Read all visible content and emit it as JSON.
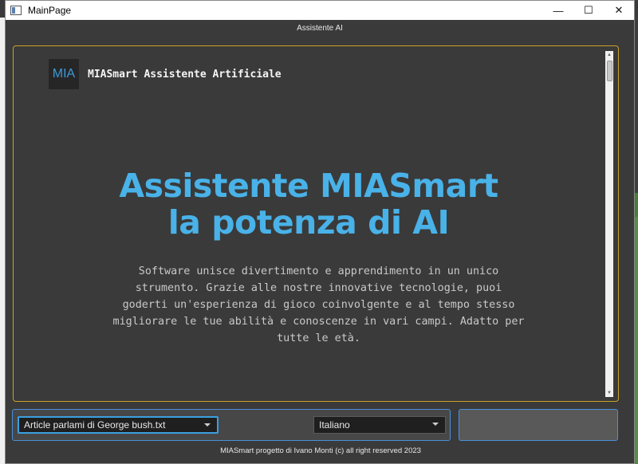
{
  "window": {
    "title": "MainPage",
    "minimize_glyph": "—",
    "maximize_glyph": "☐",
    "close_glyph": "✕"
  },
  "header": {
    "subtitle": "Assistente AI"
  },
  "brand": {
    "logo_text": "MIA",
    "name": "MIASmart Assistente Artificiale"
  },
  "hero": {
    "line1": "Assistente MIASmart",
    "line2": "la potenza di AI"
  },
  "description": {
    "lines": [
      "Software unisce divertimento e apprendimento in un unico",
      "strumento. Grazie alle nostre innovative tecnologie, puoi",
      "goderti un'esperienza di gioco coinvolgente e al tempo stesso",
      "migliorare le tue abilità e conoscenze in vari campi. Adatto per",
      "tutte le età."
    ]
  },
  "controls": {
    "article_select": "Article   parlami di George bush.txt",
    "language_select": "Italiano"
  },
  "footer": {
    "text": "MIASmart progetto di Ivano Monti (c) all right reserved 2023"
  },
  "colors": {
    "accent": "#49b2e8",
    "content_border": "#c9a227",
    "focus_border": "#3aa0e0"
  }
}
